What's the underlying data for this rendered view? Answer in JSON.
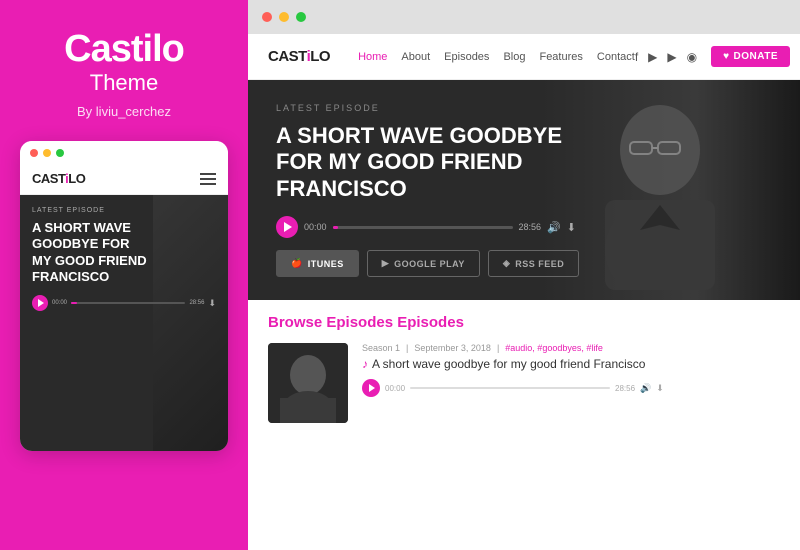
{
  "left": {
    "brand_title": "Castilo",
    "brand_subtitle": "Theme",
    "brand_author": "By liviu_cerchez",
    "dots": [
      "red",
      "yellow",
      "green"
    ],
    "mobile_logo": "CAST",
    "mobile_logo_accent": "i",
    "mobile_logo_end": "LO",
    "latest_label": "LATEST EPISODE",
    "episode_title": "A SHORT WAVE GOODBYE FOR MY GOOD FRIEND FRANCISCO",
    "time_start": "00:00",
    "time_end": "28:56"
  },
  "right": {
    "browser_dots": [
      "red",
      "yellow",
      "green"
    ],
    "nav": {
      "logo": "CAST",
      "logo_accent": "i",
      "logo_end": "LO",
      "links": [
        "Home",
        "About",
        "Episodes",
        "Blog",
        "Features",
        "Contact"
      ],
      "active_link": "Home",
      "donate_label": "DONATE"
    },
    "hero": {
      "latest_label": "LATEST EPISODE",
      "title": "A SHORT WAVE GOODBYE FOR MY GOOD FRIEND FRANCISCO",
      "time_start": "00:00",
      "time_end": "28:56",
      "btn_itunes": "ITUNES",
      "btn_googleplay": "GOOGLE PLAY",
      "btn_rss": "RSS FEED"
    },
    "browse": {
      "heading": "Browse",
      "heading_accent": "Episodes",
      "episode": {
        "season": "Season 1",
        "date": "September 3, 2018",
        "tags": "#audio, #goodbyes, #life",
        "title": "A short wave goodbye for my good friend Francisco",
        "time_start": "00:00",
        "time_end": "28:56"
      }
    }
  }
}
